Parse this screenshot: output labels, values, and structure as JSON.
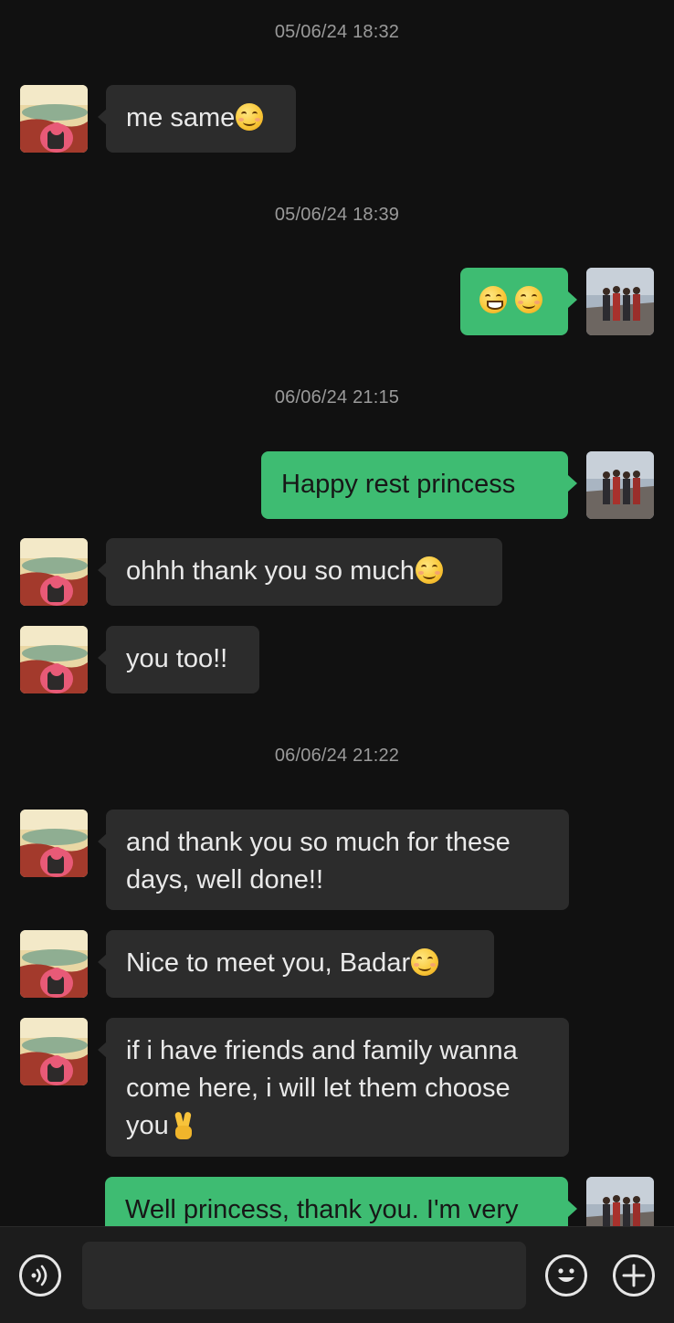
{
  "timestamps": [
    "05/06/24 18:32",
    "05/06/24 18:39",
    "06/06/24 21:15",
    "06/06/24 21:22"
  ],
  "messages": {
    "m1": "me same",
    "m3": "Happy rest princess",
    "m4": "ohhh thank you so much",
    "m5": "you too!!",
    "m6": "and thank you so much for these days, well done!!",
    "m7": "Nice to meet you, Badar",
    "m8": "if i have friends and family wanna come here, i will let them choose you",
    "m9": "Well princess, thank you. I'm very"
  },
  "emoji_icons": {
    "m1": "smiling-face-icon",
    "m2": [
      "grinning-face-icon",
      "smiling-face-icon"
    ],
    "m4": "relieved-smiling-face-icon",
    "m7": "smiling-face-icon",
    "m8": "victory-hand-icon"
  },
  "input": {
    "value": "",
    "voice_icon": "voice-icon",
    "emoji_icon": "emoji-face-icon",
    "add_icon": "plus-icon"
  },
  "colors": {
    "background": "#111111",
    "incoming_bubble": "#2c2c2c",
    "outgoing_bubble": "#3ebc72",
    "timestamp": "#9a9a9a"
  }
}
